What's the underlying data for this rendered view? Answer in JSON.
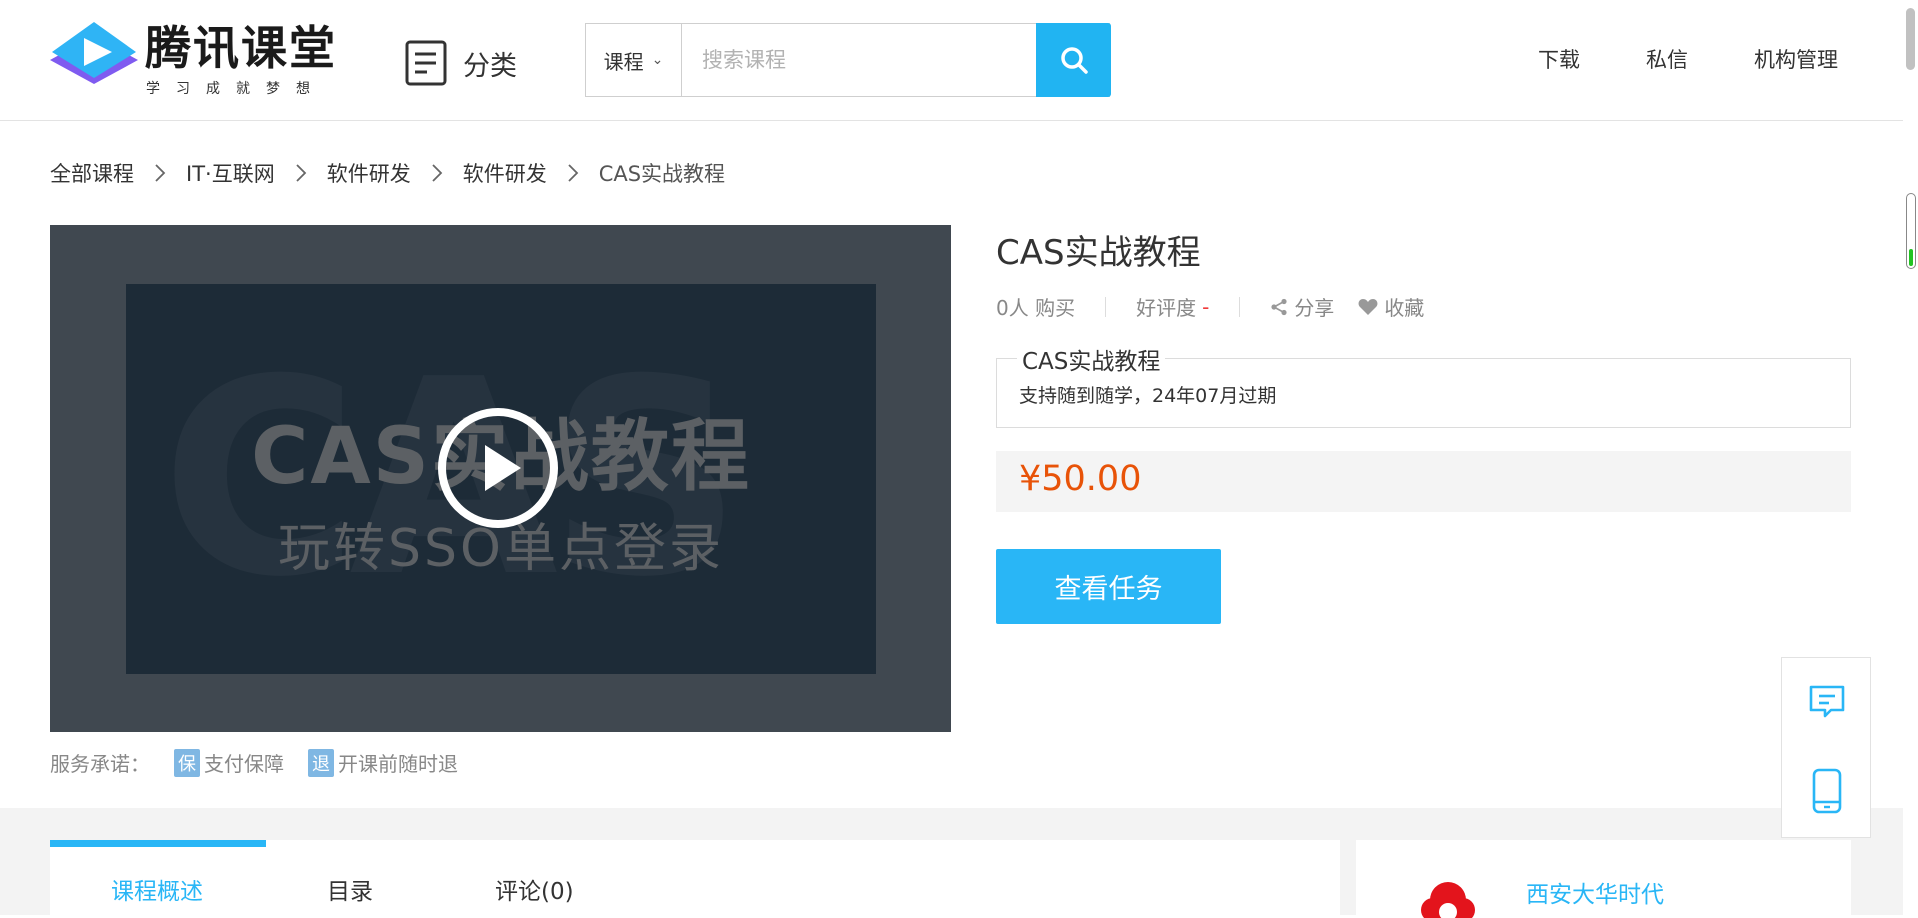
{
  "header": {
    "logo_title": "腾讯课堂",
    "logo_slogan": "学习成就梦想",
    "category_label": "分类",
    "search_type": "课程",
    "search_placeholder": "搜索课程",
    "links": [
      "下载",
      "私信",
      "机构管理"
    ]
  },
  "breadcrumb": [
    "全部课程",
    "IT·互联网",
    "软件研发",
    "软件研发",
    "CAS实战教程"
  ],
  "video": {
    "cover_title": "CAS实战教程",
    "cover_subtitle": "玩转SSO单点登录",
    "cover_bg_text": "CAS"
  },
  "service": {
    "label": "服务承诺：",
    "items": [
      {
        "icon_char": "保",
        "text": "支付保障"
      },
      {
        "icon_char": "退",
        "text": "开课前随时退"
      }
    ]
  },
  "course": {
    "title": "CAS实战教程",
    "buyers": "0人 购买",
    "rating_label": "好评度",
    "rating_value": "-",
    "share_label": "分享",
    "collect_label": "收藏",
    "box_legend": "CAS实战教程",
    "box_text": "支持随到随学，24年07月过期",
    "price": "¥50.00",
    "cta_label": "查看任务"
  },
  "tabs": [
    {
      "label": "课程概述",
      "active": true
    },
    {
      "label": "目录",
      "active": false
    },
    {
      "label": "评论(0)",
      "active": false
    }
  ],
  "org": {
    "name": "西安大华时代"
  },
  "colors": {
    "accent": "#29b6f6",
    "price": "#e85308",
    "rating": "#f03a3a"
  }
}
